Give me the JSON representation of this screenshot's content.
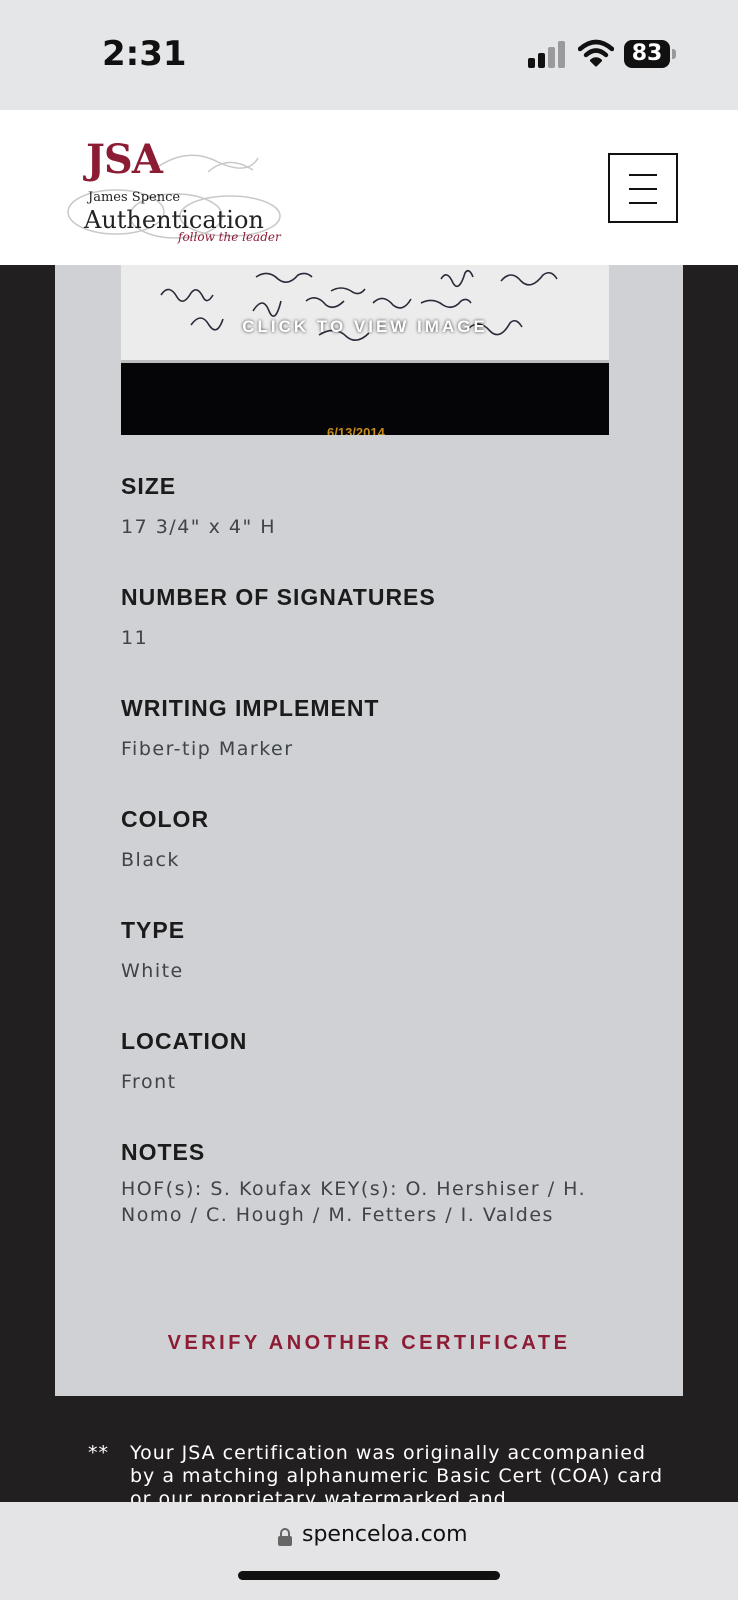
{
  "status_bar": {
    "time": "2:31",
    "battery": "83"
  },
  "header": {
    "logo": {
      "jsa": "JSA",
      "name": "James Spence",
      "authentication": "Authentication",
      "tagline": "follow the leader"
    },
    "menu_icon": "hamburger-icon"
  },
  "image": {
    "overlay_text": "CLICK TO VIEW IMAGE",
    "date": "6/13/2014"
  },
  "fields": [
    {
      "label": "SIZE",
      "value": "17 3/4\" x 4\" H"
    },
    {
      "label": "NUMBER OF SIGNATURES",
      "value": "11"
    },
    {
      "label": "WRITING IMPLEMENT",
      "value": "Fiber-tip Marker"
    },
    {
      "label": "COLOR",
      "value": "Black"
    },
    {
      "label": "TYPE",
      "value": "White"
    },
    {
      "label": "LOCATION",
      "value": "Front"
    },
    {
      "label": "NOTES",
      "value": "HOF(s): S. Koufax KEY(s): O. Hershiser / H. Nomo / C. Hough / M. Fetters / I. Valdes"
    }
  ],
  "verify_label": "VERIFY ANOTHER CERTIFICATE",
  "footnote": {
    "mark": "**",
    "text": "Your JSA certification was originally accompanied by a matching alphanumeric Basic Cert (COA) card or our proprietary watermarked and"
  },
  "url_bar": {
    "url": "spenceloa.com"
  },
  "colors": {
    "brand": "#8c1b34",
    "card_bg": "#d0d1d4",
    "page_bg": "#221f20"
  }
}
